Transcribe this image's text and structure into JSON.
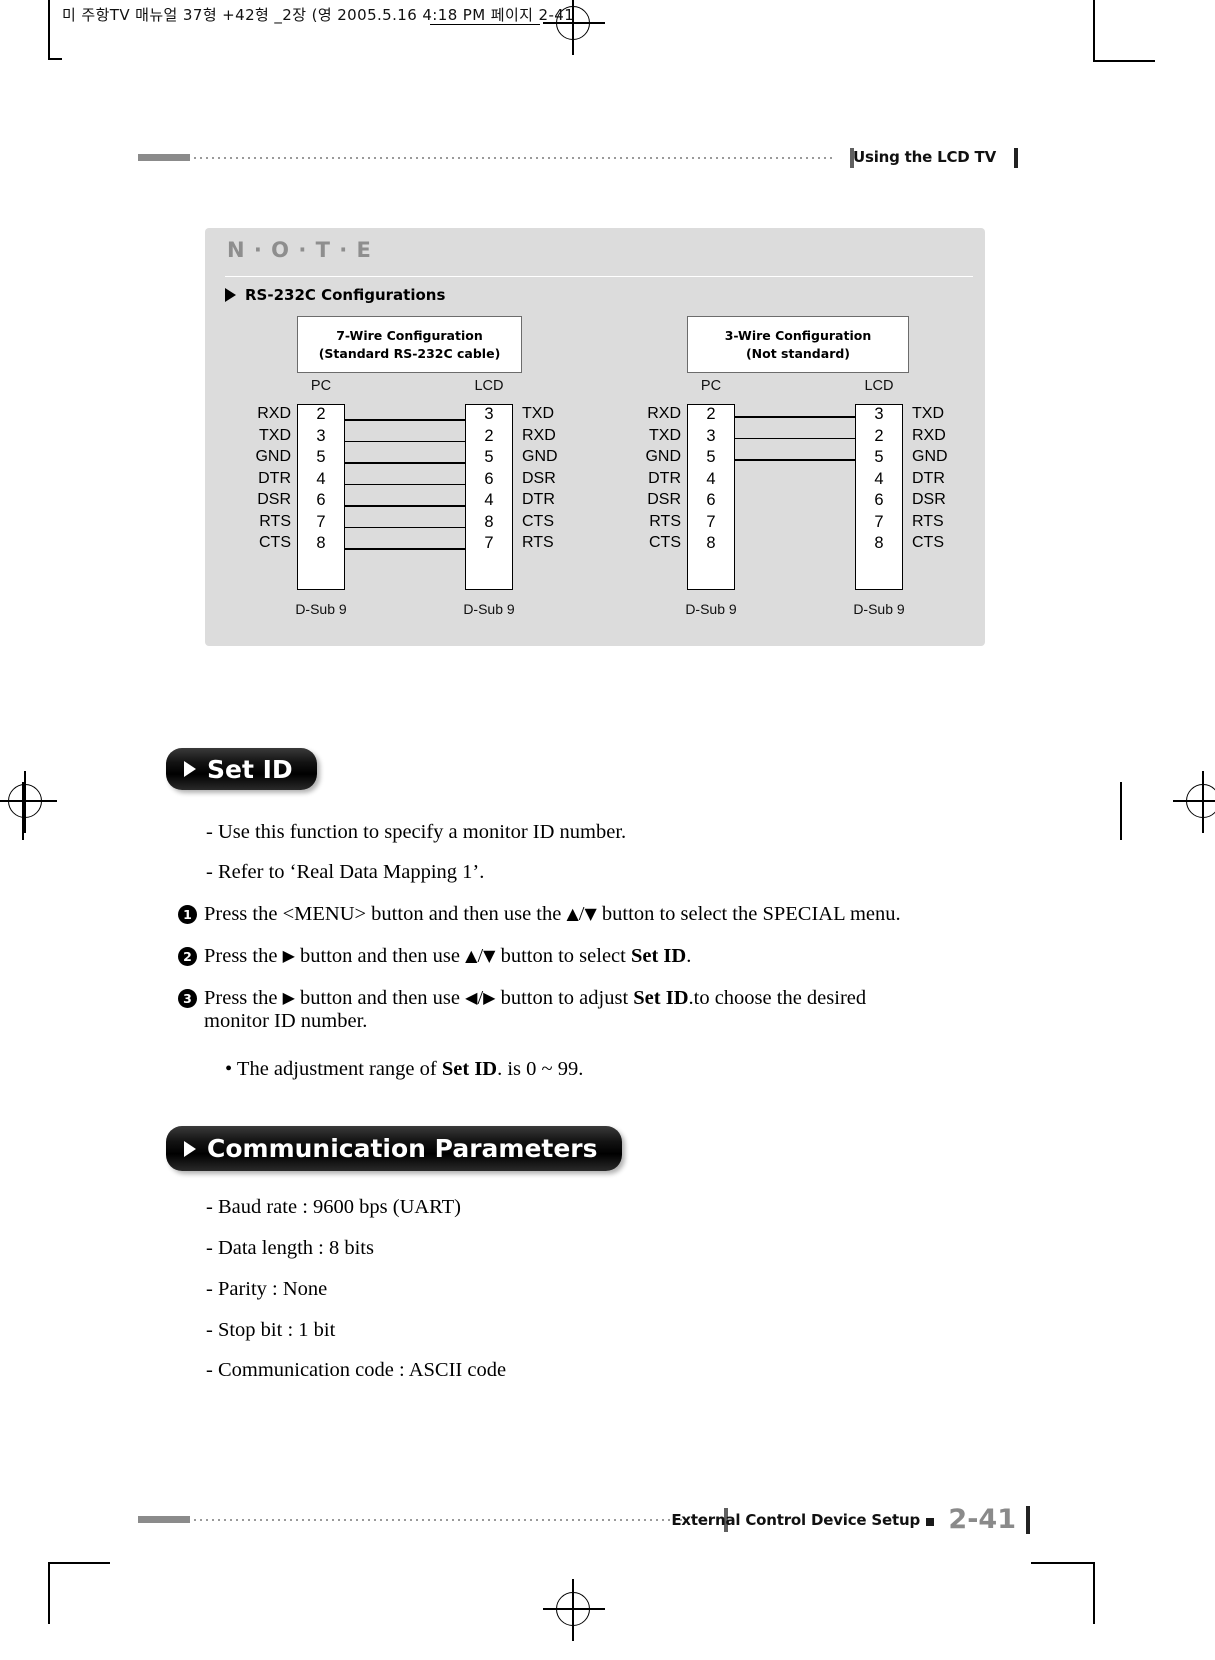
{
  "slug": {
    "text": "미 주항TV 매뉴얼 37형 +42형 _2장 (영   2005.5.16 4:18 PM  페이지 2-41"
  },
  "header": {
    "title": "Using the LCD TV"
  },
  "note": {
    "title": "N · O · T · E",
    "subtitle": "RS-232C Configurations",
    "diagrams": [
      {
        "config_title_line1": "7-Wire Configuration",
        "config_title_line2": "(Standard RS-232C cable)",
        "left_end_label": "PC",
        "right_end_label": "LCD",
        "left_connector_label": "D-Sub 9",
        "right_connector_label": "D-Sub 9",
        "rows": [
          {
            "left_signal": "RXD",
            "left_pin": "2",
            "right_pin": "3",
            "right_signal": "TXD",
            "wired": true,
            "target_row": 0
          },
          {
            "left_signal": "TXD",
            "left_pin": "3",
            "right_pin": "2",
            "right_signal": "RXD",
            "wired": true,
            "target_row": 1
          },
          {
            "left_signal": "GND",
            "left_pin": "5",
            "right_pin": "5",
            "right_signal": "GND",
            "wired": true,
            "target_row": 2
          },
          {
            "left_signal": "DTR",
            "left_pin": "4",
            "right_pin": "6",
            "right_signal": "DSR",
            "wired": true,
            "target_row": 3
          },
          {
            "left_signal": "DSR",
            "left_pin": "6",
            "right_pin": "4",
            "right_signal": "DTR",
            "wired": true,
            "target_row": 4
          },
          {
            "left_signal": "RTS",
            "left_pin": "7",
            "right_pin": "8",
            "right_signal": "CTS",
            "wired": true,
            "target_row": 5
          },
          {
            "left_signal": "CTS",
            "left_pin": "8",
            "right_pin": "7",
            "right_signal": "RTS",
            "wired": true,
            "target_row": 6
          }
        ]
      },
      {
        "config_title_line1": "3-Wire Configuration",
        "config_title_line2": "(Not standard)",
        "left_end_label": "PC",
        "right_end_label": "LCD",
        "left_connector_label": "D-Sub 9",
        "right_connector_label": "D-Sub 9",
        "rows": [
          {
            "left_signal": "RXD",
            "left_pin": "2",
            "right_pin": "3",
            "right_signal": "TXD",
            "wired": true,
            "target_row": 0
          },
          {
            "left_signal": "TXD",
            "left_pin": "3",
            "right_pin": "2",
            "right_signal": "RXD",
            "wired": true,
            "target_row": 1
          },
          {
            "left_signal": "GND",
            "left_pin": "5",
            "right_pin": "5",
            "right_signal": "GND",
            "wired": true,
            "target_row": 2
          },
          {
            "left_signal": "DTR",
            "left_pin": "4",
            "right_pin": "4",
            "right_signal": "DTR",
            "wired": false,
            "target_row": 3
          },
          {
            "left_signal": "DSR",
            "left_pin": "6",
            "right_pin": "6",
            "right_signal": "DSR",
            "wired": false,
            "target_row": 4
          },
          {
            "left_signal": "RTS",
            "left_pin": "7",
            "right_pin": "7",
            "right_signal": "RTS",
            "wired": false,
            "target_row": 5
          },
          {
            "left_signal": "CTS",
            "left_pin": "8",
            "right_pin": "8",
            "right_signal": "CTS",
            "wired": false,
            "target_row": 6
          }
        ]
      }
    ]
  },
  "set_id": {
    "pill_label": "Set ID",
    "bullets": [
      "- Use this function to specify a monitor ID number.",
      "- Refer to ‘Real Data Mapping 1’."
    ],
    "steps": [
      {
        "number": "❶",
        "html": "Press the &lt;MENU&gt; button and then use the <span class=\"glyph\">▲</span>/<span class=\"glyph\">▼</span> button to select the SPECIAL menu."
      },
      {
        "number": "❷",
        "html": "Press the <span class=\"glyph\">▶</span> button and then use <span class=\"glyph\">▲</span>/<span class=\"glyph\">▼</span> button to select <b class=\"tight\">Set ID</b>."
      },
      {
        "number": "❸",
        "html": "Press the <span class=\"glyph\">▶</span> button and then use <span class=\"glyph\">◀</span>/<span class=\"glyph\">▶</span> button to adjust <b class=\"tight\">Set ID</b>.to choose the desired<span class=\"cont\">monitor ID number.</span>"
      }
    ],
    "note_html": "• The adjustment range of <b class=\"tight\">Set ID</b>. is 0 ~ 99."
  },
  "communication": {
    "pill_label": "Communication Parameters",
    "items": [
      "- Baud rate : 9600 bps (UART)",
      "- Data length : 8 bits",
      "- Parity : None",
      "- Stop bit : 1 bit",
      "- Communication code : ASCII code"
    ]
  },
  "footer": {
    "label": "External Control Device Setup",
    "page": "2-41"
  },
  "colors": {
    "note_panel_bg": "#dcdcdc",
    "note_title": "#8e8e8e",
    "pill_bg": "#000000",
    "page_number": "#8a8a8a",
    "rule": "#8b8b8b"
  }
}
